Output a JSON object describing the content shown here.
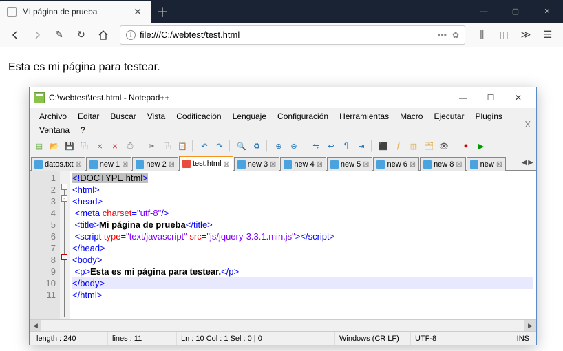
{
  "browser": {
    "tab_title": "Mi página de prueba",
    "url": "file:///C:/webtest/test.html",
    "page_text": "Esta es mi página para testear."
  },
  "npp": {
    "title": "C:\\webtest\\test.html - Notepad++",
    "menus": [
      "Archivo",
      "Editar",
      "Buscar",
      "Vista",
      "Codificación",
      "Lenguaje",
      "Configuración",
      "Herramientas",
      "Macro",
      "Ejecutar",
      "Plugins",
      "Ventana",
      "?"
    ],
    "tabs": [
      {
        "label": "datos.txt",
        "active": false,
        "dirty": false
      },
      {
        "label": "new 1",
        "active": false,
        "dirty": false
      },
      {
        "label": "new 2",
        "active": false,
        "dirty": false
      },
      {
        "label": "test.html",
        "active": true,
        "dirty": true
      },
      {
        "label": "new 3",
        "active": false,
        "dirty": false
      },
      {
        "label": "new 4",
        "active": false,
        "dirty": false
      },
      {
        "label": "new 5",
        "active": false,
        "dirty": false
      },
      {
        "label": "new 6",
        "active": false,
        "dirty": false
      },
      {
        "label": "new 8",
        "active": false,
        "dirty": false
      },
      {
        "label": "new",
        "active": false,
        "dirty": false
      }
    ],
    "code_lines": [
      {
        "n": 1,
        "html": "<span class='hl-sel'><span class='t-tag'>&lt;!</span><span class='t-doc'>DOCTYPE html</span><span class='t-tag'>&gt;</span></span>"
      },
      {
        "n": 2,
        "html": "<span class='t-tag'>&lt;html&gt;</span>"
      },
      {
        "n": 3,
        "html": "<span class='t-tag'>&lt;head&gt;</span>"
      },
      {
        "n": 4,
        "html": " <span class='t-tag'>&lt;meta</span> <span class='t-attr'>charset</span><span class='t-tag'>=</span><span class='t-str'>\"utf-8\"</span><span class='t-tag'>/&gt;</span>"
      },
      {
        "n": 5,
        "html": " <span class='t-tag'>&lt;title&gt;</span><span class='t-txt'>Mi página de prueba</span><span class='t-tag'>&lt;/title&gt;</span>"
      },
      {
        "n": 6,
        "html": " <span class='t-tag'>&lt;script</span> <span class='t-attr'>type</span><span class='t-tag'>=</span><span class='t-str'>\"text/javascript\"</span> <span class='t-attr'>src</span><span class='t-tag'>=</span><span class='t-str'>\"js/jquery-3.3.1.min.js\"</span><span class='t-tag'>&gt;&lt;/script&gt;</span>"
      },
      {
        "n": 7,
        "html": "<span class='t-tag'>&lt;/head&gt;</span>"
      },
      {
        "n": 8,
        "html": "<span class='t-tag'>&lt;body&gt;</span>"
      },
      {
        "n": 9,
        "html": " <span class='t-tag'>&lt;p&gt;</span><span class='t-txt'>Esta es mi página para testear.</span><span class='t-tag'>&lt;/p&gt;</span>"
      },
      {
        "n": 10,
        "html": "<span class='t-tag'>&lt;/body&gt;</span>",
        "current": true
      },
      {
        "n": 11,
        "html": "<span class='t-tag'>&lt;/html&gt;</span>"
      }
    ],
    "status": {
      "length_label": "length : 240",
      "lines_label": "lines : 11",
      "pos_label": "Ln : 10    Col : 1    Sel : 0 | 0",
      "eol": "Windows (CR LF)",
      "enc": "UTF-8",
      "mode": "INS"
    }
  }
}
